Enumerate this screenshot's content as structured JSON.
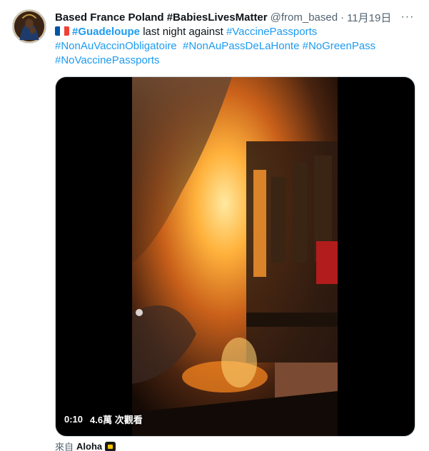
{
  "tweet": {
    "display_name": "Based France Poland #BabiesLivesMatter",
    "handle": "@from_based",
    "separator": "·",
    "date": "11月19日",
    "more_glyph": "···",
    "flag": {
      "name": "france-flag-icon",
      "colors": [
        "#0055a4",
        "#ffffff",
        "#ef4135"
      ]
    },
    "text": {
      "tag1": "#Guadeloupe",
      "mid1": " last night against ",
      "tag2": "#VaccinePassports",
      "tag3": "#NonAuVaccinObligatoire",
      "tag4": "#NonAuPassDeLaHonte",
      "tag5": "#NoGreenPass",
      "tag6": "#NoVaccinePassports"
    },
    "media": {
      "duration": "0:10",
      "views": "4.6萬 次觀看"
    },
    "source": {
      "prefix": "來自",
      "app": "Aloha",
      "app_icon": "aloha-app-icon"
    }
  },
  "colors": {
    "text": "#0f1419",
    "secondary": "#536471",
    "link": "#1d9bf0",
    "border": "#cfd9de"
  }
}
